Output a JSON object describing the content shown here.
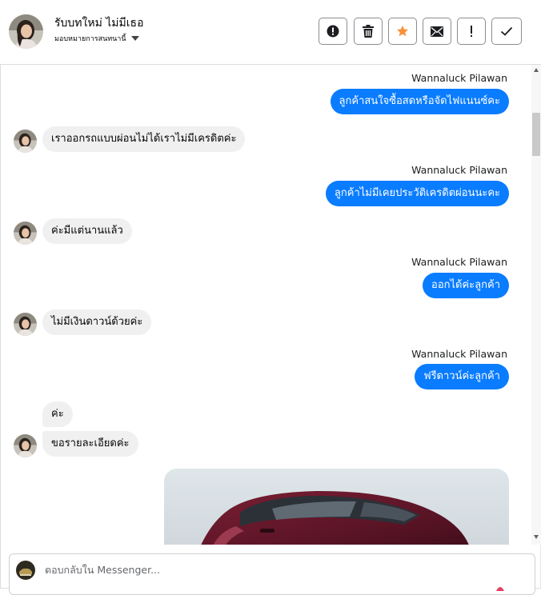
{
  "header": {
    "title": "รับบทใหม่ ไม่มีเธอ",
    "subtitle": "มอบหมายการสนทนานี้",
    "actions": [
      {
        "name": "report-button",
        "icon": "alert-circle-icon",
        "glyph": "!"
      },
      {
        "name": "delete-button",
        "icon": "trash-icon"
      },
      {
        "name": "star-button",
        "icon": "star-icon",
        "color": "#f7923a"
      },
      {
        "name": "mark-unread-button",
        "icon": "envelope-icon"
      },
      {
        "name": "priority-button",
        "icon": "exclamation-icon",
        "glyph": "!"
      },
      {
        "name": "done-button",
        "icon": "check-icon"
      }
    ]
  },
  "messages": [
    {
      "from": "page",
      "sender": "Wannaluck Pilawan",
      "text": "ลูกค้าสนใจซื้อสดหรือจัดไฟแนนซ์คะ"
    },
    {
      "from": "customer",
      "text": "เราออกรถแบบผ่อนไม่ได้เราไม่มีเครดิตค่ะ"
    },
    {
      "from": "page",
      "sender": "Wannaluck Pilawan",
      "text": "ลูกค้าไม่มีเคยประวัติเครดิตผ่อนนะคะ"
    },
    {
      "from": "customer",
      "text": "ค่ะมีแต่นานแล้ว"
    },
    {
      "from": "page",
      "sender": "Wannaluck Pilawan",
      "text": "ออกได้ค่ะลูกค้า"
    },
    {
      "from": "customer",
      "text": "ไม่มีเงินดาวน์ด้วยค่ะ"
    },
    {
      "from": "page",
      "sender": "Wannaluck Pilawan",
      "text": "ฟรีดาวน์ค่ะลูกค้า"
    },
    {
      "from": "customer",
      "text": "ค่ะ"
    },
    {
      "from": "customer",
      "text": "ขอรายละเอียดค่ะ"
    }
  ],
  "reply": {
    "placeholder": "ตอบกลับใน Messenger..."
  },
  "colors": {
    "outgoing_bubble": "#0a7cff",
    "incoming_bubble": "#f0f0f0",
    "accent_star": "#f7923a"
  }
}
